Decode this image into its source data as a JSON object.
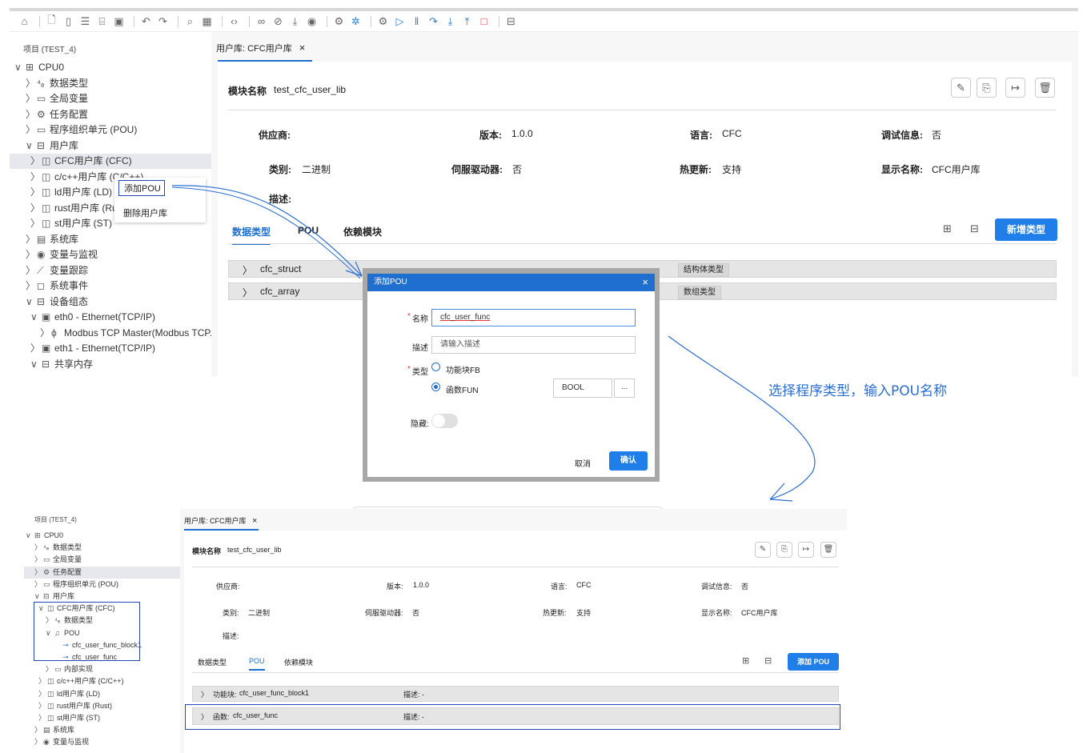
{
  "toolbar": {
    "icons": [
      "home-icon",
      "new-file-icon",
      "device-icon",
      "list-icon",
      "open-folder-icon",
      "save-icon",
      "undo-icon",
      "redo-icon",
      "search-icon",
      "build-icon",
      "code-icon",
      "link-icon",
      "unlink-icon",
      "download-icon",
      "online-icon",
      "settings-icon",
      "debug-icon",
      "compile-icon",
      "run-icon",
      "pause-icon",
      "step-icon",
      "step-into-icon",
      "step-out-icon",
      "stop-icon",
      "package-icon"
    ]
  },
  "top": {
    "project_title": "项目 (TEST_4)",
    "tree": [
      {
        "label": "CPU0",
        "arrow": "∨",
        "icon": "⊞"
      },
      {
        "label": "数据类型",
        "arrow": "〉",
        "icon": "⁴ₑ"
      },
      {
        "label": "全局变量",
        "arrow": "〉",
        "icon": "▭"
      },
      {
        "label": "任务配置",
        "arrow": "〉",
        "icon": "⚙"
      },
      {
        "label": "程序组织单元 (POU)",
        "arrow": "〉",
        "icon": "▭"
      },
      {
        "label": "用户库",
        "arrow": "∨",
        "icon": "⊟"
      },
      {
        "label": "CFC用户库 (CFC)",
        "arrow": "〉",
        "icon": "◫"
      },
      {
        "label": "c/c++用户库 (C/C++)",
        "arrow": "〉",
        "icon": "◫"
      },
      {
        "label": "ld用户库 (LD)",
        "arrow": "〉",
        "icon": "◫"
      },
      {
        "label": "rust用户库 (Rust)",
        "arrow": "〉",
        "icon": "◫"
      },
      {
        "label": "st用户库 (ST)",
        "arrow": "〉",
        "icon": "◫"
      },
      {
        "label": "系统库",
        "arrow": "〉",
        "icon": "▤"
      },
      {
        "label": "变量与监视",
        "arrow": "〉",
        "icon": "◉"
      },
      {
        "label": "变量跟踪",
        "arrow": "〉",
        "icon": "⟋"
      },
      {
        "label": "系统事件",
        "arrow": "〉",
        "icon": "◻"
      },
      {
        "label": "设备组态",
        "arrow": "∨",
        "icon": "⊟"
      },
      {
        "label": "eth0 - Ethernet(TCP/IP)",
        "arrow": "∨",
        "icon": "▣"
      },
      {
        "label": "Modbus TCP Master(Modbus TCP...",
        "arrow": "〉",
        "icon": "ϕ"
      },
      {
        "label": "eth1 - Ethernet(TCP/IP)",
        "arrow": "〉",
        "icon": "▣"
      },
      {
        "label": "共享内存",
        "arrow": "∨",
        "icon": "⊟"
      }
    ],
    "tab_label": "用户库: CFC用户库",
    "tab_close": "×",
    "module_name_label": "模块名称",
    "module_name": "test_cfc_user_lib",
    "info": {
      "vendor_label": "供应商:",
      "vendor": "",
      "version_label": "版本:",
      "version": "1.0.0",
      "language_label": "语言:",
      "language": "CFC",
      "debug_label": "调试信息:",
      "debug": "否",
      "category_label": "类别:",
      "category": "二进制",
      "servo_label": "伺服驱动器:",
      "servo": "否",
      "hotupdate_label": "热更新:",
      "hotupdate": "支持",
      "display_label": "显示名称:",
      "display": "CFC用户库",
      "desc_label": "描述:"
    },
    "subtabs": [
      "数据类型",
      "POU",
      "依赖模块"
    ],
    "add_type_button": "新增类型",
    "rows": [
      {
        "name": "cfc_struct",
        "tag": "结构体类型"
      },
      {
        "name": "cfc_array",
        "tag": "数组类型"
      }
    ],
    "context_menu": [
      "添加POU",
      "删除用户库"
    ]
  },
  "dialog": {
    "title": "添加POU",
    "name_label": "名称",
    "name_value": "cfc_user_func",
    "desc_label": "描述",
    "desc_placeholder": "请输入描述",
    "type_label": "类型",
    "option_fb": "功能块FB",
    "option_fun": "函数FUN",
    "return_type": "BOOL",
    "browse": "...",
    "hidden_label": "隐藏:",
    "cancel": "取消",
    "confirm": "确认",
    "required_mark": "*"
  },
  "annotation_text": "选择程序类型，输入POU名称",
  "bottom": {
    "project_title": "项目 (TEST_4)",
    "tree": [
      {
        "label": "CPU0",
        "arrow": "∨",
        "icon": "⊞"
      },
      {
        "label": "数据类型",
        "arrow": "〉",
        "icon": "⁴ₑ"
      },
      {
        "label": "全局变量",
        "arrow": "〉",
        "icon": "▭"
      },
      {
        "label": "任务配置",
        "arrow": "〉",
        "icon": "⚙"
      },
      {
        "label": "程序组织单元 (POU)",
        "arrow": "〉",
        "icon": "▭"
      },
      {
        "label": "用户库",
        "arrow": "∨",
        "icon": "⊟"
      },
      {
        "label": "CFC用户库 (CFC)",
        "arrow": "∨",
        "icon": "◫"
      },
      {
        "label": "数据类型",
        "arrow": "〉",
        "icon": "⁴ₑ"
      },
      {
        "label": "POU",
        "arrow": "∨",
        "icon": "♫"
      },
      {
        "label": "cfc_user_func_block1",
        "arrow": "",
        "icon": "⊸"
      },
      {
        "label": "cfc_user_func",
        "arrow": "",
        "icon": "⊸"
      },
      {
        "label": "内部实现",
        "arrow": "〉",
        "icon": "▭"
      },
      {
        "label": "c/c++用户库 (C/C++)",
        "arrow": "〉",
        "icon": "◫"
      },
      {
        "label": "ld用户库 (LD)",
        "arrow": "〉",
        "icon": "◫"
      },
      {
        "label": "rust用户库 (Rust)",
        "arrow": "〉",
        "icon": "◫"
      },
      {
        "label": "st用户库 (ST)",
        "arrow": "〉",
        "icon": "◫"
      },
      {
        "label": "系统库",
        "arrow": "〉",
        "icon": "▤"
      },
      {
        "label": "变量与监视",
        "arrow": "〉",
        "icon": "◉"
      }
    ],
    "tab_label": "用户库: CFC用户库",
    "tab_close": "×",
    "module_name_label": "模块名称",
    "module_name": "test_cfc_user_lib",
    "subtabs": [
      "数据类型",
      "POU",
      "依赖模块"
    ],
    "add_pou_button": "添加 POU",
    "rows": [
      {
        "kind": "功能块:",
        "name": "cfc_user_func_block1",
        "desc": "描述: -"
      },
      {
        "kind": "函数:",
        "name": "cfc_user_func",
        "desc": "描述: -"
      }
    ]
  }
}
